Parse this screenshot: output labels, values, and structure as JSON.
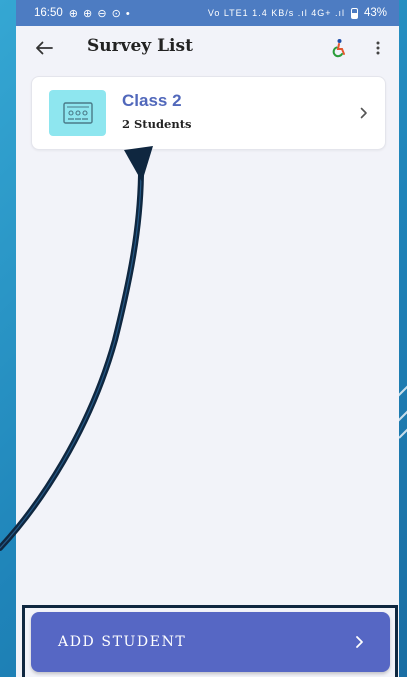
{
  "status_bar": {
    "time": "16:50",
    "notification_icons": "⊕ ⊕ ⊖ ⊙ •",
    "network_info": "Vo LTE1 1.4 KB/s .ıl 4G+ .ıl",
    "battery": "43%"
  },
  "app_bar": {
    "title": "Survey List"
  },
  "survey_items": [
    {
      "title": "Class 2",
      "subtitle": "2 Students"
    }
  ],
  "bottom_action": {
    "label": "ADD STUDENT"
  },
  "colors": {
    "status_bar": "#4d7cc2",
    "screen_bg": "#f2f3f9",
    "accent": "#5168bb",
    "button": "#5667c4",
    "thumb": "#8ee6ef",
    "annotation_arrow": "#0f2740"
  },
  "icons": {
    "back": "arrow-left-icon",
    "accessibility": "accessibility-icon",
    "more": "more-vertical-icon",
    "classroom": "classroom-icon",
    "chevron": "chevron-right-icon"
  }
}
